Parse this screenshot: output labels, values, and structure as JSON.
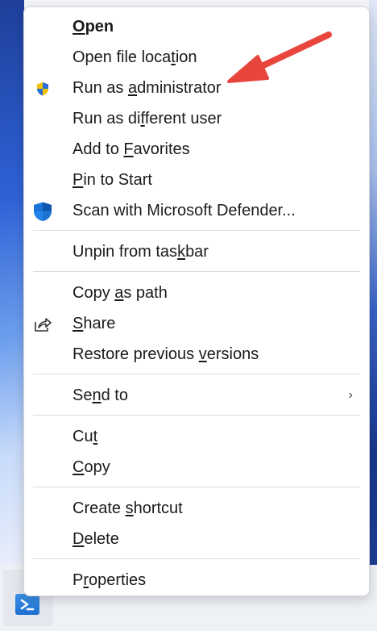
{
  "context_menu": {
    "groups": [
      [
        {
          "id": "open",
          "pre": "",
          "u": "O",
          "post": "pen",
          "bold": true,
          "icon": null
        },
        {
          "id": "open-file-location",
          "pre": "Open file loca",
          "u": "t",
          "post": "ion",
          "icon": null
        },
        {
          "id": "run-as-administrator",
          "pre": "Run as ",
          "u": "a",
          "post": "dministrator",
          "icon": "uac-shield-icon"
        },
        {
          "id": "run-as-different-user",
          "pre": "Run as di",
          "u": "f",
          "post": "ferent user",
          "icon": null
        },
        {
          "id": "add-to-favorites",
          "pre": "Add to ",
          "u": "F",
          "post": "avorites",
          "icon": null
        },
        {
          "id": "pin-to-start",
          "pre": "",
          "u": "P",
          "post": "in to Start",
          "icon": null
        },
        {
          "id": "scan-with-defender",
          "pre": "Scan with Microsoft Defender...",
          "u": "",
          "post": "",
          "icon": "defender-shield-icon"
        }
      ],
      [
        {
          "id": "unpin-from-taskbar",
          "pre": "Unpin from tas",
          "u": "k",
          "post": "bar",
          "icon": null
        }
      ],
      [
        {
          "id": "copy-as-path",
          "pre": "Copy ",
          "u": "a",
          "post": "s path",
          "icon": null
        },
        {
          "id": "share",
          "pre": "",
          "u": "S",
          "post": "hare",
          "icon": "share-icon"
        },
        {
          "id": "restore-previous-versions",
          "pre": "Restore previous ",
          "u": "v",
          "post": "ersions",
          "icon": null
        }
      ],
      [
        {
          "id": "send-to",
          "pre": "Se",
          "u": "n",
          "post": "d to",
          "icon": null,
          "submenu": true
        }
      ],
      [
        {
          "id": "cut",
          "pre": "Cu",
          "u": "t",
          "post": "",
          "icon": null
        },
        {
          "id": "copy",
          "pre": "",
          "u": "C",
          "post": "opy",
          "icon": null
        }
      ],
      [
        {
          "id": "create-shortcut",
          "pre": "Create ",
          "u": "s",
          "post": "hortcut",
          "icon": null
        },
        {
          "id": "delete",
          "pre": "",
          "u": "D",
          "post": "elete",
          "icon": null
        }
      ],
      [
        {
          "id": "properties",
          "pre": "P",
          "u": "r",
          "post": "operties",
          "icon": null
        }
      ]
    ],
    "submenu_glyph": "›"
  },
  "taskbar": {
    "pinned_app_icon": "powershell-icon"
  },
  "colors": {
    "annotation_arrow": "#e8463c",
    "defender_blue": "#1a73d9",
    "uac_blue": "#2b6fd6",
    "uac_yellow": "#f2c200"
  }
}
